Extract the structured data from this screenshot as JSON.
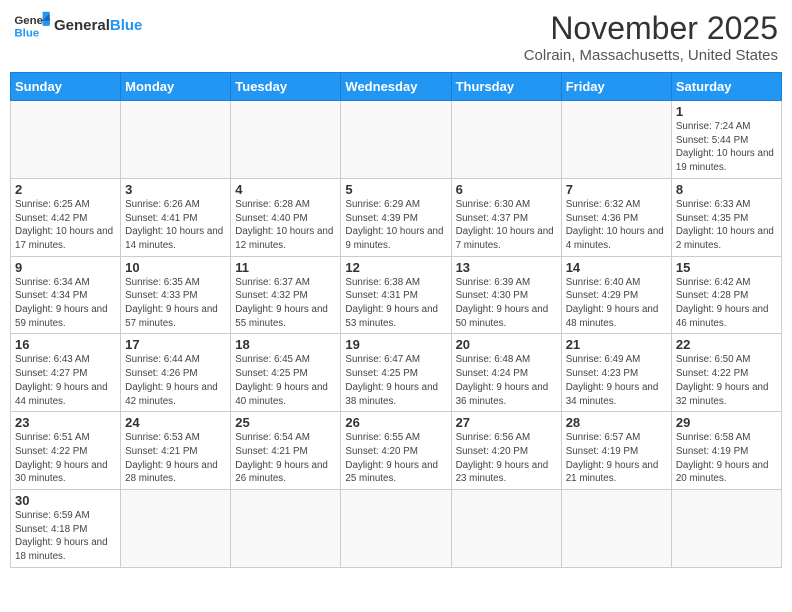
{
  "header": {
    "logo_general": "General",
    "logo_blue": "Blue",
    "month_title": "November 2025",
    "location": "Colrain, Massachusetts, United States"
  },
  "days_of_week": [
    "Sunday",
    "Monday",
    "Tuesday",
    "Wednesday",
    "Thursday",
    "Friday",
    "Saturday"
  ],
  "weeks": [
    [
      {
        "day": "",
        "info": ""
      },
      {
        "day": "",
        "info": ""
      },
      {
        "day": "",
        "info": ""
      },
      {
        "day": "",
        "info": ""
      },
      {
        "day": "",
        "info": ""
      },
      {
        "day": "",
        "info": ""
      },
      {
        "day": "1",
        "info": "Sunrise: 7:24 AM\nSunset: 5:44 PM\nDaylight: 10 hours and 19 minutes."
      }
    ],
    [
      {
        "day": "2",
        "info": "Sunrise: 6:25 AM\nSunset: 4:42 PM\nDaylight: 10 hours and 17 minutes."
      },
      {
        "day": "3",
        "info": "Sunrise: 6:26 AM\nSunset: 4:41 PM\nDaylight: 10 hours and 14 minutes."
      },
      {
        "day": "4",
        "info": "Sunrise: 6:28 AM\nSunset: 4:40 PM\nDaylight: 10 hours and 12 minutes."
      },
      {
        "day": "5",
        "info": "Sunrise: 6:29 AM\nSunset: 4:39 PM\nDaylight: 10 hours and 9 minutes."
      },
      {
        "day": "6",
        "info": "Sunrise: 6:30 AM\nSunset: 4:37 PM\nDaylight: 10 hours and 7 minutes."
      },
      {
        "day": "7",
        "info": "Sunrise: 6:32 AM\nSunset: 4:36 PM\nDaylight: 10 hours and 4 minutes."
      },
      {
        "day": "8",
        "info": "Sunrise: 6:33 AM\nSunset: 4:35 PM\nDaylight: 10 hours and 2 minutes."
      }
    ],
    [
      {
        "day": "9",
        "info": "Sunrise: 6:34 AM\nSunset: 4:34 PM\nDaylight: 9 hours and 59 minutes."
      },
      {
        "day": "10",
        "info": "Sunrise: 6:35 AM\nSunset: 4:33 PM\nDaylight: 9 hours and 57 minutes."
      },
      {
        "day": "11",
        "info": "Sunrise: 6:37 AM\nSunset: 4:32 PM\nDaylight: 9 hours and 55 minutes."
      },
      {
        "day": "12",
        "info": "Sunrise: 6:38 AM\nSunset: 4:31 PM\nDaylight: 9 hours and 53 minutes."
      },
      {
        "day": "13",
        "info": "Sunrise: 6:39 AM\nSunset: 4:30 PM\nDaylight: 9 hours and 50 minutes."
      },
      {
        "day": "14",
        "info": "Sunrise: 6:40 AM\nSunset: 4:29 PM\nDaylight: 9 hours and 48 minutes."
      },
      {
        "day": "15",
        "info": "Sunrise: 6:42 AM\nSunset: 4:28 PM\nDaylight: 9 hours and 46 minutes."
      }
    ],
    [
      {
        "day": "16",
        "info": "Sunrise: 6:43 AM\nSunset: 4:27 PM\nDaylight: 9 hours and 44 minutes."
      },
      {
        "day": "17",
        "info": "Sunrise: 6:44 AM\nSunset: 4:26 PM\nDaylight: 9 hours and 42 minutes."
      },
      {
        "day": "18",
        "info": "Sunrise: 6:45 AM\nSunset: 4:25 PM\nDaylight: 9 hours and 40 minutes."
      },
      {
        "day": "19",
        "info": "Sunrise: 6:47 AM\nSunset: 4:25 PM\nDaylight: 9 hours and 38 minutes."
      },
      {
        "day": "20",
        "info": "Sunrise: 6:48 AM\nSunset: 4:24 PM\nDaylight: 9 hours and 36 minutes."
      },
      {
        "day": "21",
        "info": "Sunrise: 6:49 AM\nSunset: 4:23 PM\nDaylight: 9 hours and 34 minutes."
      },
      {
        "day": "22",
        "info": "Sunrise: 6:50 AM\nSunset: 4:22 PM\nDaylight: 9 hours and 32 minutes."
      }
    ],
    [
      {
        "day": "23",
        "info": "Sunrise: 6:51 AM\nSunset: 4:22 PM\nDaylight: 9 hours and 30 minutes."
      },
      {
        "day": "24",
        "info": "Sunrise: 6:53 AM\nSunset: 4:21 PM\nDaylight: 9 hours and 28 minutes."
      },
      {
        "day": "25",
        "info": "Sunrise: 6:54 AM\nSunset: 4:21 PM\nDaylight: 9 hours and 26 minutes."
      },
      {
        "day": "26",
        "info": "Sunrise: 6:55 AM\nSunset: 4:20 PM\nDaylight: 9 hours and 25 minutes."
      },
      {
        "day": "27",
        "info": "Sunrise: 6:56 AM\nSunset: 4:20 PM\nDaylight: 9 hours and 23 minutes."
      },
      {
        "day": "28",
        "info": "Sunrise: 6:57 AM\nSunset: 4:19 PM\nDaylight: 9 hours and 21 minutes."
      },
      {
        "day": "29",
        "info": "Sunrise: 6:58 AM\nSunset: 4:19 PM\nDaylight: 9 hours and 20 minutes."
      }
    ],
    [
      {
        "day": "30",
        "info": "Sunrise: 6:59 AM\nSunset: 4:18 PM\nDaylight: 9 hours and 18 minutes."
      },
      {
        "day": "",
        "info": ""
      },
      {
        "day": "",
        "info": ""
      },
      {
        "day": "",
        "info": ""
      },
      {
        "day": "",
        "info": ""
      },
      {
        "day": "",
        "info": ""
      },
      {
        "day": "",
        "info": ""
      }
    ]
  ]
}
